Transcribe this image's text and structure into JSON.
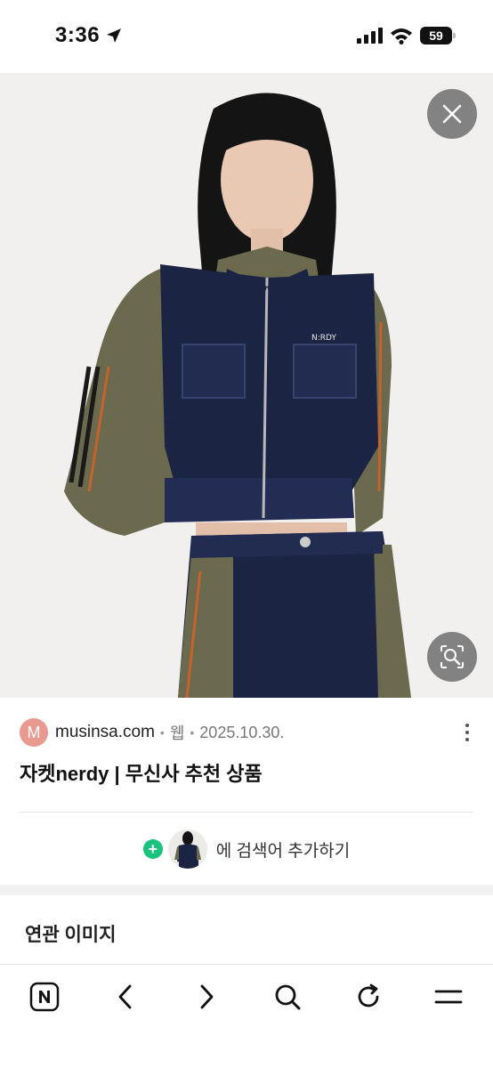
{
  "status_bar": {
    "time": "3:36",
    "battery": "59"
  },
  "result": {
    "favicon_letter": "M",
    "domain": "musinsa.com",
    "type": "웹",
    "date": "2025.10.30.",
    "title": "자켓nerdy | 무신사 추천 상품"
  },
  "image": {
    "logo_text": "N:RDY"
  },
  "add_search": {
    "label": "에 검색어 추가하기"
  },
  "related": {
    "heading": "연관 이미지"
  },
  "colors": {
    "accent_green": "#19c37d",
    "favicon_bg": "#e89a90",
    "denim": "#1c2444",
    "khaki": "#6b6a4e"
  },
  "icons": {
    "close": "close-icon",
    "lens": "image-search-icon",
    "home": "naver-home-icon",
    "back": "chevron-left-icon",
    "forward": "chevron-right-icon",
    "search": "search-icon",
    "reload": "reload-icon",
    "menu": "menu-icon"
  }
}
